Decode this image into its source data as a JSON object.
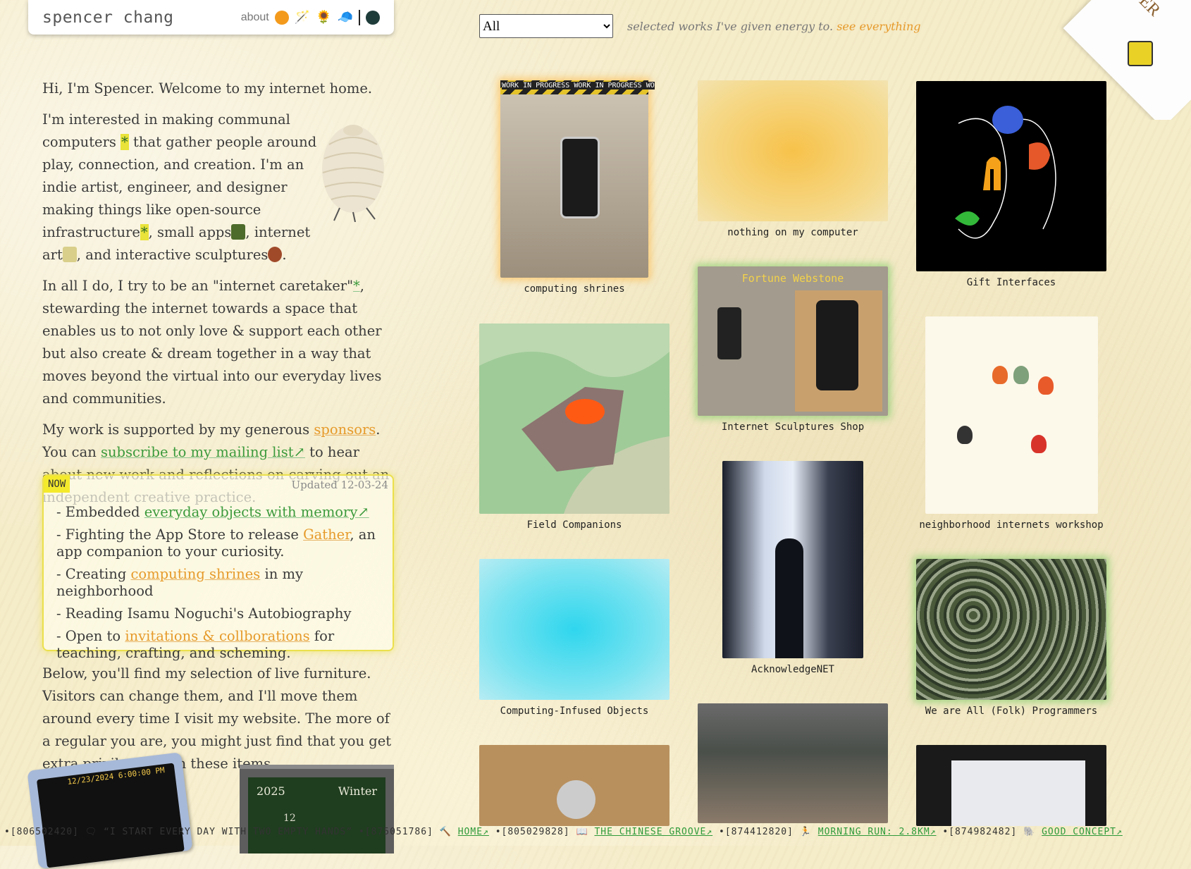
{
  "header": {
    "title": "spencer chang",
    "nav_about": "about",
    "icons": [
      "orange-circle",
      "magic-wand",
      "sunflower",
      "blue-cap",
      "divider",
      "dark-circle"
    ]
  },
  "intro": {
    "greeting": "Hi, I'm Spencer. Welcome to my internet home.",
    "p2_a": "I'm interested in making communal computers ",
    "p2_star": "*",
    "p2_b": " that gather people around play, connection, and creation. I'm an indie artist, engineer, and designer making things like open-source infrastructure",
    "p2_star2": "*",
    "p2_c": ", small apps",
    "p2_d": ", internet art",
    "p2_e": ", and interactive sculptures",
    "p2_f": ".",
    "p3_a": "In all I do, I try to be an \"internet caretaker\"",
    "p3_star": "*",
    "p3_b": ", stewarding the internet towards a space that enables us to not only love & support each other but also create & dream together in a way that moves beyond the virtual into our everyday lives and communities.",
    "p4_a": "My work is supported by my generous ",
    "p4_sponsors": "sponsors",
    "p4_b": ". You can ",
    "p4_subscribe": "subscribe to my mailing list↗",
    "p4_c": " to hear about new work and reflections on carving out an independent creative practice."
  },
  "now": {
    "tag": "NOW",
    "updated": "Updated 12-03-24",
    "i1_a": "- Embedded ",
    "i1_link": "everyday objects with memory↗",
    "i2_a": "- Fighting the App Store to release ",
    "i2_link": "Gather",
    "i2_b": ", an app companion to your curiosity.",
    "i3_a": "- Creating ",
    "i3_link": "computing shrines",
    "i3_b": " in my neighborhood",
    "i4": "- Reading Isamu Noguchi's Autobiography",
    "i5_a": "- Open to ",
    "i5_link": "invitations & collborations",
    "i5_b": " for teaching, crafting, and scheming."
  },
  "below": "Below, you'll find my selection of live furniture. Visitors can change them, and I'll move them around every time I visit my website. The more of a regular you are, you might just find that you get extra privileges with these items...",
  "furniture": {
    "tablet_time": "12/23/2024 6:00:00 PM",
    "cal_year": "2025",
    "cal_season": "Winter",
    "cal_day": "12"
  },
  "filter": {
    "selected": "All",
    "note_a": "selected works I've given energy to. ",
    "note_link": "see everything"
  },
  "corner": {
    "text": "A WIP FOREVER"
  },
  "works": {
    "w1": "computing shrines",
    "w2": "nothing on my computer",
    "w3": "Gift Interfaces",
    "w4": "Field Companions",
    "w5": "Internet Sculptures Shop",
    "w5_banner": "Fortune Webstone",
    "w6": "neighborhood internets workshop",
    "w7": "AcknowledgeNET",
    "w8": "Computing-Infused Objects",
    "w9": "We are All (Folk) Programmers",
    "wip_banner": "WORK IN PROGRESS  WORK IN PROGRESS  WO"
  },
  "ticker": {
    "t1": "•[806502420] 🗨 “I START EVERY DAY WITH TWO EMPTY HANDS” •[875051786] 🔨 ",
    "t1_link": "HOME↗",
    "t2": " •[805029828] 📖 ",
    "t2_link": "THE CHINESE GROOVE↗",
    "t3": " •[874412820] 🏃 ",
    "t3_link": "MORNING RUN: 2.8KM↗",
    "t4": " •[874982482] 🐘 ",
    "t4_link": "GOOD CONCEPT↗"
  }
}
